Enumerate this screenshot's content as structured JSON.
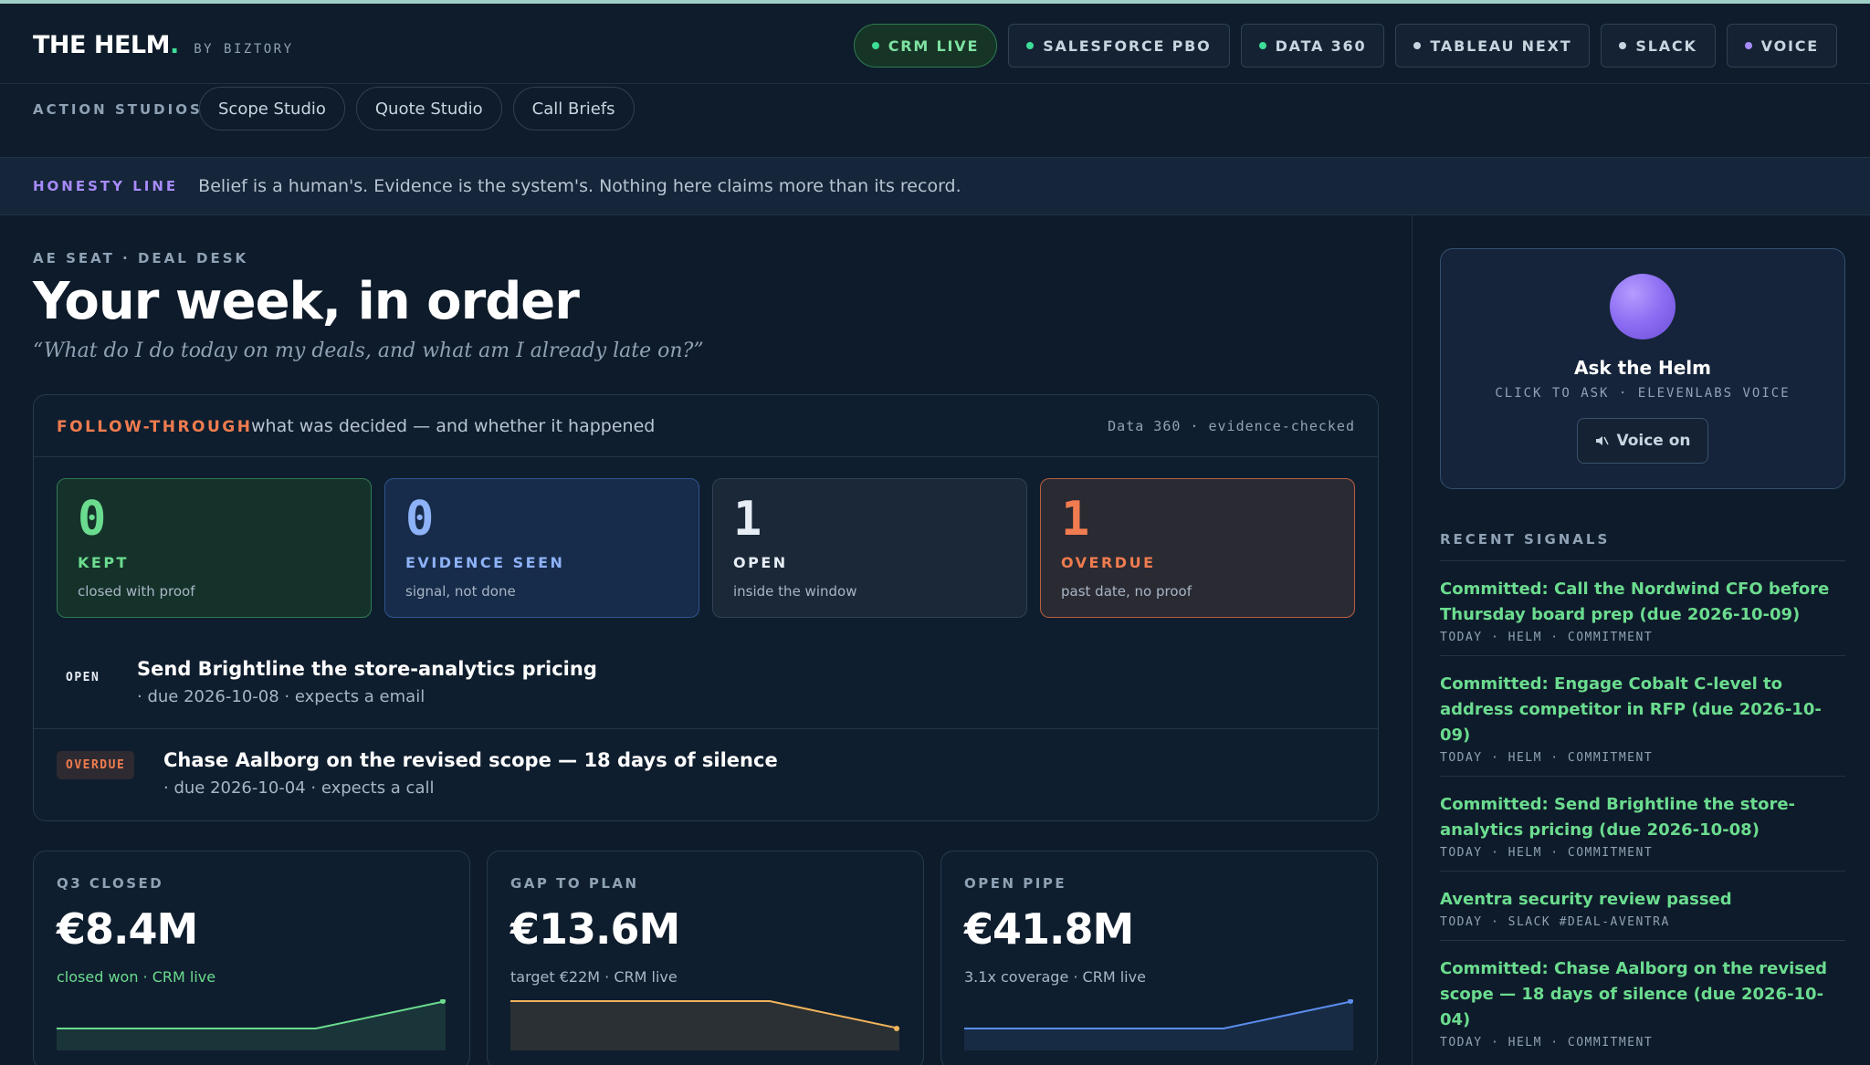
{
  "brand": {
    "name": "THE HELM",
    "dot": ".",
    "by": "BY BIZTORY"
  },
  "integrations": [
    {
      "label": "CRM LIVE",
      "dot_color": "#3ddc97"
    },
    {
      "label": "SALESFORCE PBO",
      "dot_color": "#3ddc97"
    },
    {
      "label": "DATA 360",
      "dot_color": "#3ddc97"
    },
    {
      "label": "TABLEAU NEXT",
      "dot_color": "#c8d4df"
    },
    {
      "label": "SLACK",
      "dot_color": "#c8d4df"
    },
    {
      "label": "VOICE",
      "dot_color": "#a78bfa"
    }
  ],
  "studios": {
    "label": "ACTION STUDIOS",
    "buttons": [
      "Scope Studio",
      "Quote Studio",
      "Call Briefs"
    ]
  },
  "honesty": {
    "label": "HONESTY LINE",
    "text": "Belief is a human's. Evidence is the system's. Nothing here claims more than its record."
  },
  "header": {
    "eyebrow": "AE SEAT · DEAL DESK",
    "title": "Your week, in order",
    "subtitle": "“What do I do today on my deals, and what am I already late on?”"
  },
  "follow_through": {
    "label": "FOLLOW-THROUGH",
    "description": "what was decided — and whether it happened",
    "meta": "Data 360 · evidence-checked",
    "tiles": [
      {
        "value": "0",
        "label": "KEPT",
        "sub": "closed with proof"
      },
      {
        "value": "0",
        "label": "EVIDENCE SEEN",
        "sub": "signal, not done"
      },
      {
        "value": "1",
        "label": "OPEN",
        "sub": "inside the window"
      },
      {
        "value": "1",
        "label": "OVERDUE",
        "sub": "past date, no proof"
      }
    ],
    "commitments": [
      {
        "status": "OPEN",
        "title": "Send Brightline the store-analytics pricing",
        "detail": "· due 2026-10-08 · expects a email"
      },
      {
        "status": "OVERDUE",
        "title": "Chase Aalborg on the revised scope — 18 days of silence",
        "detail": "· due 2026-10-04 · expects a call"
      }
    ]
  },
  "kpis": [
    {
      "label": "Q3 CLOSED",
      "value": "€8.4M",
      "sub": "closed won · CRM live"
    },
    {
      "label": "GAP TO PLAN",
      "value": "€13.6M",
      "sub": "target €22M · CRM live"
    },
    {
      "label": "OPEN PIPE",
      "value": "€41.8M",
      "sub": "3.1x coverage · CRM live"
    }
  ],
  "chart_data": [
    {
      "type": "area",
      "x": [
        0,
        1,
        2,
        3
      ],
      "values": [
        0,
        0,
        0,
        1
      ],
      "color": "#6bdc8f"
    },
    {
      "type": "area",
      "x": [
        0,
        1,
        2,
        3
      ],
      "values": [
        1,
        1,
        1,
        0
      ],
      "color": "#f2b45c"
    },
    {
      "type": "area",
      "x": [
        0,
        1,
        2,
        3
      ],
      "values": [
        0,
        0,
        0,
        1
      ],
      "color": "#5b8def"
    }
  ],
  "ask": {
    "title": "Ask the Helm",
    "subtitle": "CLICK TO ASK · ELEVENLABS VOICE",
    "voice_icon": "speaker-icon",
    "voice_label": "Voice on"
  },
  "signals": {
    "label": "RECENT SIGNALS",
    "items": [
      {
        "title": "Committed: Call the Nordwind CFO before Thursday board prep (due 2026-10-09)",
        "meta": "TODAY · HELM · COMMITMENT"
      },
      {
        "title": "Committed: Engage Cobalt C-level to address competitor in RFP (due 2026-10-09)",
        "meta": "TODAY · HELM · COMMITMENT"
      },
      {
        "title": "Committed: Send Brightline the store-analytics pricing (due 2026-10-08)",
        "meta": "TODAY · HELM · COMMITMENT"
      },
      {
        "title": "Aventra security review passed",
        "meta": "TODAY · SLACK #DEAL-AVENTRA"
      },
      {
        "title": "Committed: Chase Aalborg on the revised scope — 18 days of silence (due 2026-10-04)",
        "meta": "TODAY · HELM · COMMITMENT"
      }
    ]
  }
}
